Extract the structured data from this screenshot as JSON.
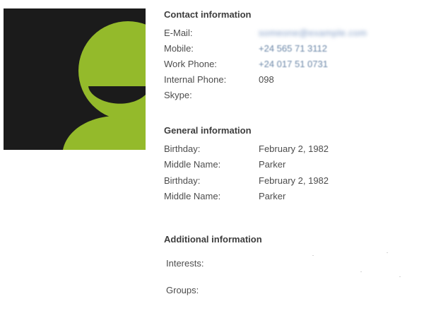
{
  "avatar": {
    "background": "#1b1b1b",
    "figure_color": "#94ba2b",
    "icon": "user-avatar-icon"
  },
  "contact": {
    "title": "Contact information",
    "rows": [
      {
        "label": "E-Mail:",
        "value": "someone@example.com"
      },
      {
        "label": "Mobile:",
        "value": "+24 565 71 3112"
      },
      {
        "label": "Work Phone:",
        "value": "+24 017 51 0731"
      },
      {
        "label": "Internal Phone:",
        "value": "098"
      },
      {
        "label": "Skype:",
        "value": ""
      }
    ]
  },
  "general": {
    "title": "General information",
    "rows": [
      {
        "label": "Birthday:",
        "value": "February 2, 1982"
      },
      {
        "label": "Middle Name:",
        "value": "Parker"
      },
      {
        "label": "Birthday:",
        "value": "February 2, 1982"
      },
      {
        "label": "Middle Name:",
        "value": "Parker"
      }
    ]
  },
  "additional": {
    "title": "Additional information",
    "rows": [
      {
        "label": "Interests:"
      },
      {
        "label": "Groups:"
      }
    ]
  }
}
